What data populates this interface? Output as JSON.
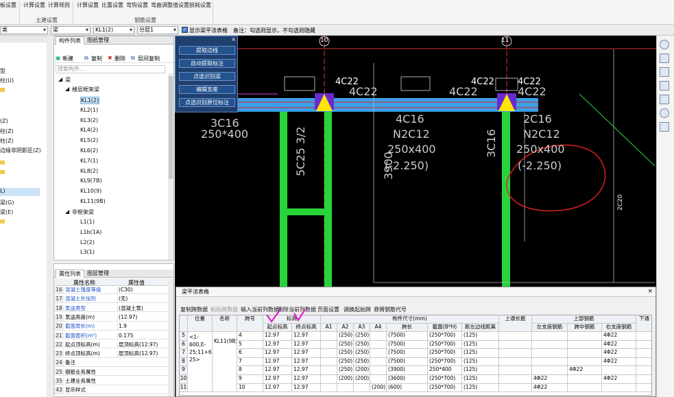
{
  "ribbon": {
    "buttons": [
      "板设置",
      "计算设置",
      "计算规则",
      "计算设置",
      "比重设置",
      "弯钩设置",
      "弯曲调整值设置",
      "损耗设置"
    ],
    "groups": [
      "土建设置",
      "钢筋设置"
    ]
  },
  "toolbar2": {
    "combo1": "类",
    "combo2": "梁",
    "combo3": "KL1(2)",
    "combo4": "分层1",
    "checkbox_label": "显示梁平法表格",
    "note": "备注：勾选则显示，不勾选则隐藏"
  },
  "left_pane": {
    "items": [
      "型",
      "柱(U)",
      "",
      "",
      "(Z)",
      "柱(Z)",
      "柱(Z)",
      "柱(Z)",
      "边缘非阴影区(Z)",
      "",
      "",
      "L)",
      "梁(G)",
      "梁(E)",
      ""
    ]
  },
  "component_panel": {
    "tabs": [
      "构件列表",
      "图纸管理"
    ],
    "toolbar": [
      "新建",
      "复制",
      "删除",
      "层间复制"
    ],
    "search_placeholder": "搜索构件...",
    "tree": {
      "root": "梁",
      "group1": "楼层框架梁",
      "kl_items": [
        "KL1(2)",
        "KL2(1)",
        "KL3(2)",
        "KL4(2)",
        "KL5(2)",
        "KL6(2)",
        "KL7(1)",
        "KL8(2)",
        "KL9(7B)",
        "KL10(9)",
        "KL11(9B)"
      ],
      "group2": "非框架梁",
      "l_items": [
        "L1(1)",
        "L1b(1A)",
        "L2(2)",
        "L3(1)"
      ]
    }
  },
  "property_panel": {
    "tabs": [
      "属性列表",
      "图层管理"
    ],
    "headers": [
      "属性名称",
      "属性值"
    ],
    "rows": [
      {
        "num": "16",
        "name": "混凝土强度等级",
        "value": "(C30)",
        "blue": true
      },
      {
        "num": "17",
        "name": "混凝土外加剂",
        "value": "(无)",
        "blue": true
      },
      {
        "num": "18",
        "name": "泵送类型",
        "value": "(混凝土泵)",
        "blue": true
      },
      {
        "num": "19",
        "name": "泵送高度(m)",
        "value": "(12.97)",
        "blue": false
      },
      {
        "num": "20",
        "name": "截面周长(m)",
        "value": "1.9",
        "blue": true
      },
      {
        "num": "21",
        "name": "截面面积(m²)",
        "value": "0.175",
        "blue": true
      },
      {
        "num": "22",
        "name": "起点顶标高(m)",
        "value": "层顶标高(12.97)",
        "blue": false
      },
      {
        "num": "23",
        "name": "终点顶标高(m)",
        "value": "层顶标高(12.97)",
        "blue": false
      },
      {
        "num": "24",
        "name": "备注",
        "value": "",
        "blue": false
      },
      {
        "num": "25",
        "name": "钢筋业务属性",
        "value": "",
        "blue": false
      },
      {
        "num": "35",
        "name": "土建业务属性",
        "value": "",
        "blue": false
      },
      {
        "num": "43",
        "name": "显示样式",
        "value": "",
        "blue": false
      }
    ]
  },
  "float_panel": {
    "buttons": [
      "提取边线",
      "自动提取标注",
      "点选识别梁",
      "编辑支座",
      "点选识别原位标注"
    ]
  },
  "canvas": {
    "axes": [
      "10",
      "11"
    ],
    "labels": [
      "4C22",
      "4C22",
      "4C22",
      "4C22",
      "3C16",
      "250*400",
      "4C16",
      "N2C12",
      "250x400",
      "(-2.250)",
      "5C25 3/2",
      "2C16",
      "N2C12",
      "250x400",
      "(-2.250)",
      "3C20",
      "3900",
      "3C16",
      "2C20"
    ]
  },
  "dialog": {
    "title": "梁平法表格",
    "toolbar": [
      "复制跨数据",
      "粘贴跨数据",
      "输入当前列数据",
      "删除当前列数据",
      "页面设置",
      "调换起始跨",
      "悬臂钢筋代号"
    ],
    "headers": {
      "pos": "位置",
      "name": "名称",
      "span": "跨号",
      "elev": "标高",
      "start_elev": "起点标高",
      "end_elev": "终点标高",
      "sec_size": "构件尺寸(mm)",
      "a1": "A1",
      "a2": "A2",
      "a3": "A3",
      "a4": "A4",
      "span_len": "跨长",
      "section": "截面(B*H)",
      "dist": "距左边线距离",
      "top_through": "上通长筋",
      "top_rebar": "上部钢筋",
      "left_support": "左支座钢筋",
      "mid_span": "跨中钢筋",
      "right_support": "右支座钢筋",
      "down": "下通"
    },
    "location": "<1-600,E-25;11+600,E-25>",
    "name": "KL11(9B)",
    "rows": [
      {
        "span": "4",
        "start": "12.97",
        "end": "12.97",
        "a1": "",
        "a2": "(250)",
        "a3": "(250)",
        "a4": "",
        "len": "(7500)",
        "sec": "(250*700)",
        "dist": "(125)",
        "left": "",
        "mid": "",
        "right": "4Φ22",
        "num": "5"
      },
      {
        "span": "5",
        "start": "12.97",
        "end": "12.97",
        "a1": "",
        "a2": "(250)",
        "a3": "(250)",
        "a4": "",
        "len": "(7500)",
        "sec": "(250*700)",
        "dist": "(125)",
        "left": "",
        "mid": "",
        "right": "4Φ22",
        "num": "6"
      },
      {
        "span": "6",
        "start": "12.97",
        "end": "12.97",
        "a1": "",
        "a2": "(250)",
        "a3": "(250)",
        "a4": "",
        "len": "(7500)",
        "sec": "(250*700)",
        "dist": "(125)",
        "left": "",
        "mid": "",
        "right": "4Φ22",
        "num": "7"
      },
      {
        "span": "7",
        "start": "12.97",
        "end": "12.97",
        "a1": "",
        "a2": "(250)",
        "a3": "(250)",
        "a4": "",
        "len": "(7500)",
        "sec": "(250*700)",
        "dist": "(125)",
        "left": "",
        "mid": "",
        "right": "4Φ22",
        "num": "8"
      },
      {
        "span": "8",
        "start": "12.97",
        "end": "12.97",
        "a1": "",
        "a2": "(250)",
        "a3": "(200)",
        "a4": "",
        "len": "(3900)",
        "sec": "250*400",
        "dist": "(125)",
        "left": "",
        "mid": "4Φ22",
        "right": "",
        "num": "9"
      },
      {
        "span": "9",
        "start": "12.97",
        "end": "12.97",
        "a1": "",
        "a2": "(200)",
        "a3": "(200)",
        "a4": "",
        "len": "(3600)",
        "sec": "(250*700)",
        "dist": "(125)",
        "left": "4Φ22",
        "mid": "",
        "right": "4Φ22",
        "num": "10"
      },
      {
        "span": "10",
        "start": "12.97",
        "end": "12.97",
        "a1": "",
        "a2": "",
        "a3": "",
        "a4": "(200)",
        "len": "(600)",
        "sec": "(250*700)",
        "dist": "(125)",
        "left": "4Φ22",
        "mid": "",
        "right": "",
        "num": "11"
      }
    ]
  },
  "colors": {
    "beam": "#3aa0e8",
    "column": "#27d43a",
    "annotation": "#e02020",
    "checkmark": "#e020c8"
  }
}
